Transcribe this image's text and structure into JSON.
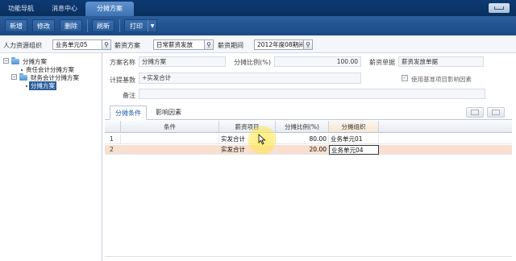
{
  "top_tabs": [
    {
      "label": "功能导航",
      "active": false
    },
    {
      "label": "消息中心",
      "active": false
    },
    {
      "label": "分摊方案",
      "active": true
    }
  ],
  "toolbar": {
    "buttons": [
      "新增",
      "修改",
      "删除",
      "刷新",
      "打印"
    ]
  },
  "query": {
    "org_label": "人力资源组织",
    "org_value": "业务单元05",
    "scheme_label": "薪资方案",
    "scheme_value": "日常薪资发放",
    "period_label": "薪资期间",
    "period_value": "2012年度08期间"
  },
  "tree": {
    "root": "分摊方案",
    "items": [
      "责任会计分摊方案",
      "财务会计分摊方案"
    ],
    "selected": "分摊方案"
  },
  "form": {
    "name_label": "方案名称",
    "name_value": "分摊方案",
    "ratio_label": "分摊比例(%)",
    "ratio_value": "100.00",
    "item_label": "薪资单据",
    "item_value": "薪资发放单据",
    "base_label": "计提基数",
    "base_value": "+实发合计",
    "use_base_label": "使用基准项目影响因素",
    "remark_label": "备注",
    "remark_value": ""
  },
  "sub_tabs": [
    {
      "label": "分摊条件",
      "active": true
    },
    {
      "label": "影响因素",
      "active": false
    }
  ],
  "grid": {
    "headers": [
      "",
      "条件",
      "薪资项目",
      "分摊比例(%)",
      "分摊组织"
    ],
    "rows": [
      {
        "no": "1",
        "condition": "",
        "item": "实发合计",
        "ratio": "80.00",
        "org": "业务单元01"
      },
      {
        "no": "2",
        "condition": "",
        "item": "实发合计",
        "ratio": "20.00",
        "org": "业务单元04"
      }
    ]
  },
  "colors": {
    "topbar": "#0d3a73",
    "toolbar": "#1a4a86",
    "selected_row": "#f8dfcf",
    "tab_active_text": "#1f5ba8"
  }
}
